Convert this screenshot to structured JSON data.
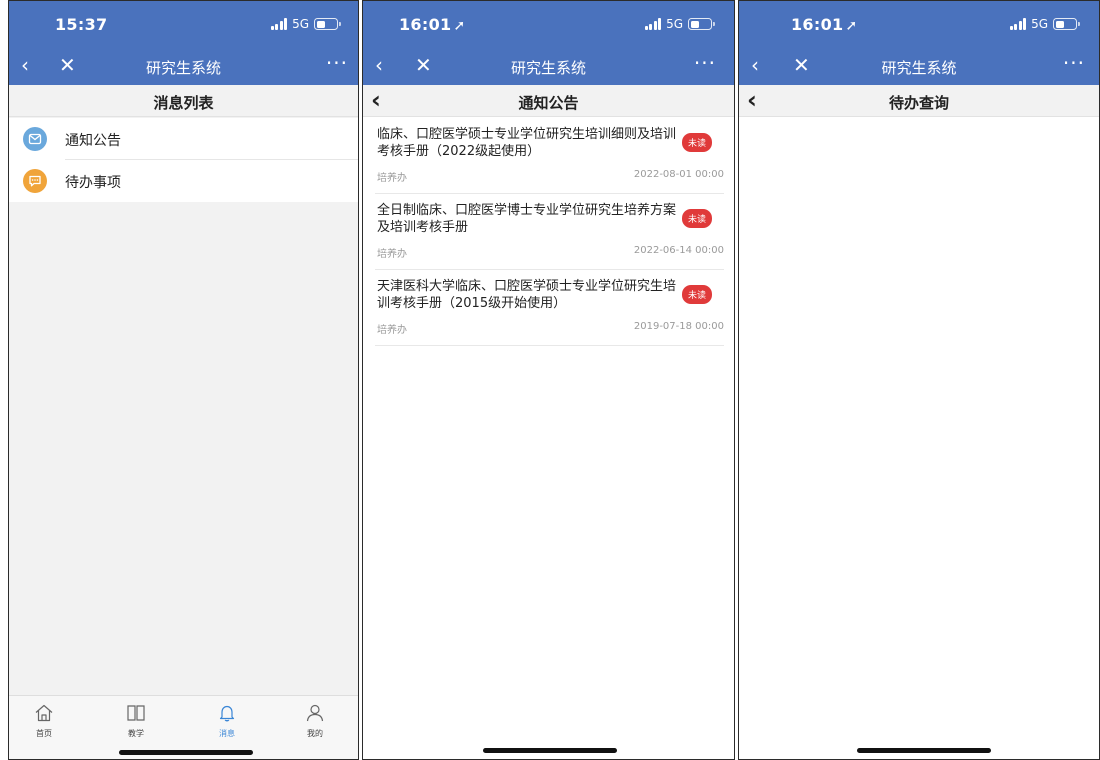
{
  "screen1": {
    "status": {
      "time": "15:37",
      "network": "5G"
    },
    "nav": {
      "back": "‹",
      "close": "✕",
      "title": "研究生系统",
      "more": "···"
    },
    "header": {
      "title": "消息列表"
    },
    "items": [
      {
        "label": "通知公告",
        "icon": "mail-icon",
        "color": "#6aa8dc"
      },
      {
        "label": "待办事项",
        "icon": "chat-icon",
        "color": "#f0a43a"
      }
    ],
    "tabs": [
      {
        "label": "首页",
        "icon": "home-icon"
      },
      {
        "label": "教学",
        "icon": "book-icon"
      },
      {
        "label": "消息",
        "icon": "bell-icon",
        "active": true
      },
      {
        "label": "我的",
        "icon": "user-icon"
      }
    ]
  },
  "screen2": {
    "status": {
      "time": "16:01",
      "network": "5G"
    },
    "nav": {
      "back": "‹",
      "close": "✕",
      "title": "研究生系统",
      "more": "···"
    },
    "header": {
      "back": "‹",
      "title": "通知公告"
    },
    "notices": [
      {
        "title": "临床、口腔医学硕士专业学位研究生培训细则及培训考核手册（2022级起使用）",
        "badge": "未读",
        "source": "培养办",
        "date": "2022-08-01 00:00"
      },
      {
        "title": "全日制临床、口腔医学博士专业学位研究生培养方案及培训考核手册",
        "badge": "未读",
        "source": "培养办",
        "date": "2022-06-14 00:00"
      },
      {
        "title": "天津医科大学临床、口腔医学硕士专业学位研究生培训考核手册（2015级开始使用）",
        "badge": "未读",
        "source": "培养办",
        "date": "2019-07-18 00:00"
      }
    ]
  },
  "screen3": {
    "status": {
      "time": "16:01",
      "network": "5G"
    },
    "nav": {
      "back": "‹",
      "close": "✕",
      "title": "研究生系统",
      "more": "···"
    },
    "header": {
      "back": "‹",
      "title": "待办查询"
    }
  },
  "colors": {
    "nav_blue": "#4a72bd",
    "badge_red": "#e03a3a",
    "tab_active": "#3a86d6"
  }
}
